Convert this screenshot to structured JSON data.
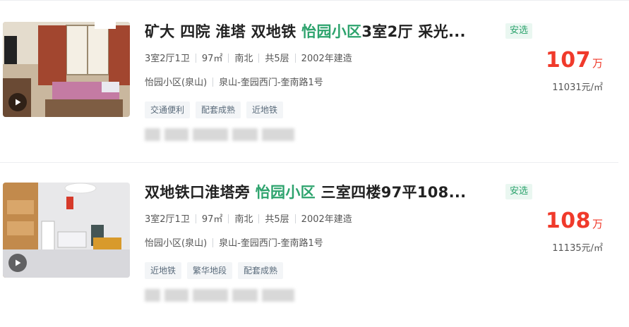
{
  "listings": [
    {
      "title_pre": "矿大 四院 淮塔 双地铁 ",
      "title_highlight": "怡园小区",
      "title_post": "3室2厅 采光...",
      "badge": "安选",
      "info": [
        "3室2厅1卫",
        "97㎡",
        "南北",
        "共5层",
        "2002年建造"
      ],
      "community": "怡园小区(泉山)",
      "address": "泉山-奎园西门-奎南路1号",
      "tags": [
        "交通便利",
        "配套成熟",
        "近地铁"
      ],
      "price": "107",
      "price_unit": "万",
      "unit_price": "11031元/㎡",
      "thumbnail_icon": "bedroom-photo",
      "video_icon": "play-icon"
    },
    {
      "title_pre": "双地铁口淮塔旁 ",
      "title_highlight": "怡园小区",
      "title_post": " 三室四楼97平108...",
      "badge": "安选",
      "info": [
        "3室2厅1卫",
        "97㎡",
        "南北",
        "共5层",
        "2002年建造"
      ],
      "community": "怡园小区(泉山)",
      "address": "泉山-奎园西门-奎南路1号",
      "tags": [
        "近地铁",
        "繁华地段",
        "配套成熟"
      ],
      "price": "108",
      "price_unit": "万",
      "unit_price": "11135元/㎡",
      "thumbnail_icon": "living-room-photo",
      "video_icon": "play-icon"
    }
  ],
  "colors": {
    "accent": "#2da36d",
    "price": "#f03a2b"
  }
}
